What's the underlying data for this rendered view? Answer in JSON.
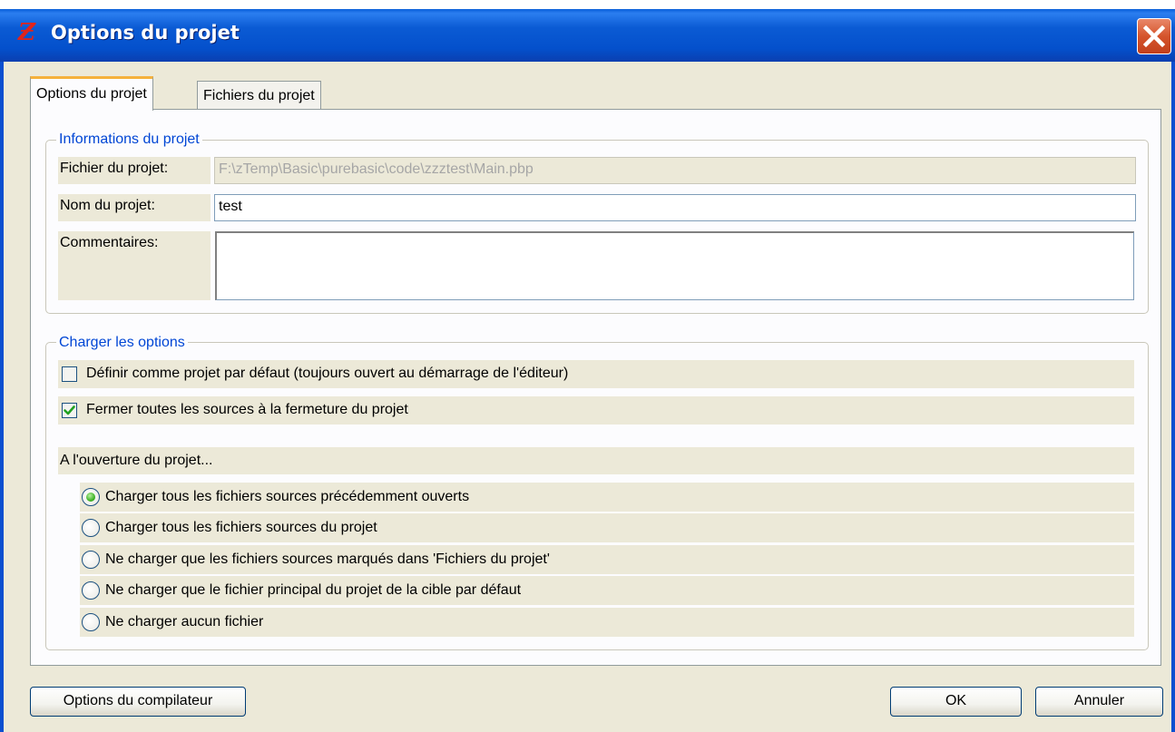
{
  "window": {
    "title": "Options du projet",
    "icon": "purebasic-app-icon",
    "close_icon": "close-icon"
  },
  "tabs": [
    {
      "label": "Options du projet",
      "active": true
    },
    {
      "label": "Fichiers du projet",
      "active": false
    }
  ],
  "project_info": {
    "group_title": "Informations du projet",
    "file_label": "Fichier du projet:",
    "file_value": "F:\\zTemp\\Basic\\purebasic\\code\\zzztest\\Main.pbp",
    "name_label": "Nom du projet:",
    "name_value": "test",
    "comments_label": "Commentaires:",
    "comments_value": ""
  },
  "load_options": {
    "group_title": "Charger les options",
    "checkboxes": [
      {
        "label": "Définir comme projet par défaut (toujours ouvert au démarrage de l'éditeur)",
        "checked": false
      },
      {
        "label": "Fermer toutes les sources à la fermeture du projet",
        "checked": true
      }
    ],
    "on_open_label": "A l'ouverture du projet...",
    "radios": [
      {
        "label": "Charger tous les fichiers sources précédemment ouverts",
        "selected": true
      },
      {
        "label": "Charger tous les fichiers sources du projet",
        "selected": false
      },
      {
        "label": "Ne charger que les fichiers sources marqués dans 'Fichiers du projet'",
        "selected": false
      },
      {
        "label": "Ne charger que le fichier principal du projet de la cible par défaut",
        "selected": false
      },
      {
        "label": "Ne charger aucun fichier",
        "selected": false
      }
    ]
  },
  "buttons": {
    "compiler_options": "Options du compilateur",
    "ok": "OK",
    "cancel": "Annuler"
  },
  "colors": {
    "titlebar": "#0450cc",
    "group_title": "#0046d5",
    "dialog_bg": "#ece9d8",
    "radio_selected": "#3fb428",
    "checkmark": "#21a121"
  }
}
